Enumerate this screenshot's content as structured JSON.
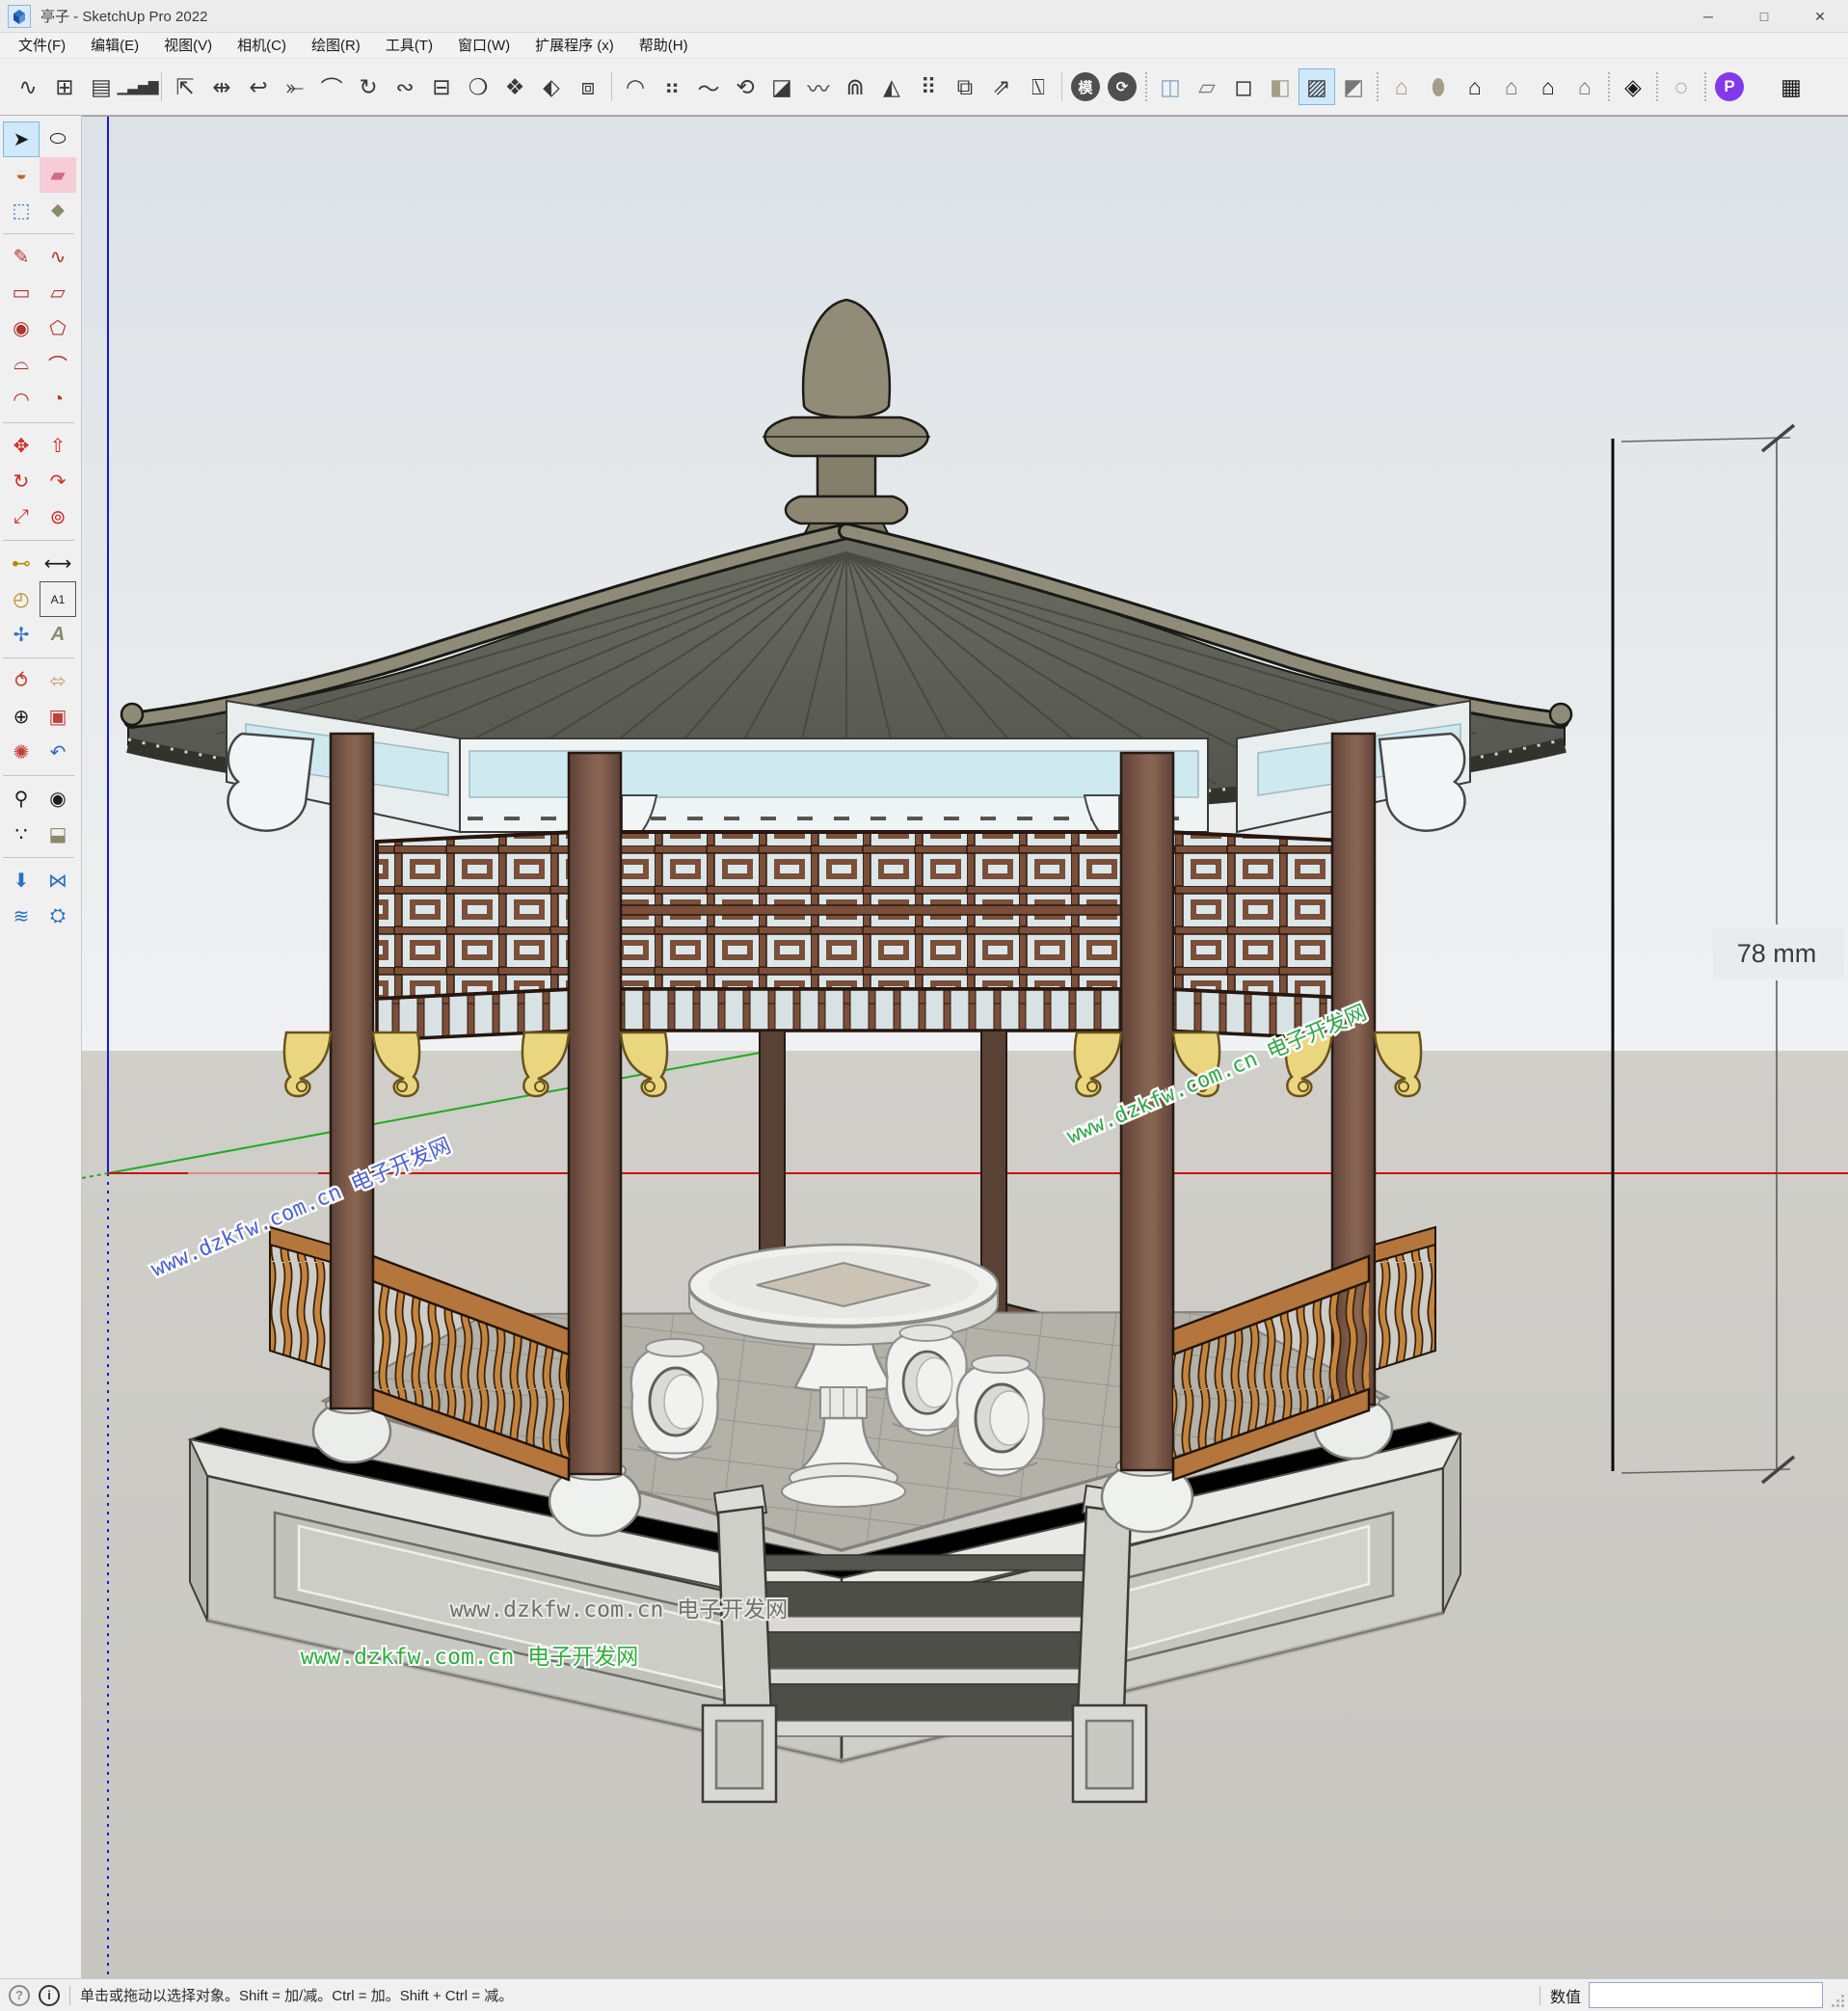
{
  "window": {
    "title": "亭子 - SketchUp Pro 2022",
    "controls": {
      "minimize": "─",
      "maximize": "□",
      "close": "✕"
    }
  },
  "menubar": {
    "items": [
      "文件(F)",
      "编辑(E)",
      "视图(V)",
      "相机(C)",
      "绘图(R)",
      "工具(T)",
      "窗口(W)",
      "扩展程序 (x)",
      "帮助(H)"
    ]
  },
  "toolbar": {
    "icons": [
      {
        "name": "curviloft",
        "glyph": "∿"
      },
      {
        "name": "default-tray",
        "glyph": "⊞"
      },
      {
        "name": "stairs-tool",
        "glyph": "▤"
      },
      {
        "name": "histogram-tool",
        "glyph": "▁▃▅▇"
      },
      {
        "name": "fredo-scale",
        "glyph": "⇱"
      },
      {
        "name": "spacing-tool",
        "glyph": "⇹"
      },
      {
        "name": "curve-bend",
        "glyph": "↩"
      },
      {
        "name": "curve-anchor",
        "glyph": "⤜"
      },
      {
        "name": "bezier-curve",
        "glyph": "⌒"
      },
      {
        "name": "loop-curve",
        "glyph": "↻"
      },
      {
        "name": "curvizard",
        "glyph": "∾"
      },
      {
        "name": "joint-pushpull",
        "glyph": "⊟"
      },
      {
        "name": "vector-pen",
        "glyph": "❍"
      },
      {
        "name": "diamond-array",
        "glyph": "❖"
      },
      {
        "name": "diamond-move",
        "glyph": "⬖"
      },
      {
        "name": "solid-select",
        "glyph": "⧈"
      },
      {
        "name": "round-corner",
        "glyph": "◠"
      },
      {
        "name": "bead-chain",
        "glyph": "⠶"
      },
      {
        "name": "curve-sketch",
        "glyph": "〜"
      },
      {
        "name": "spiral-tool",
        "glyph": "⟲"
      },
      {
        "name": "half-plane",
        "glyph": "◪"
      },
      {
        "name": "wave-hand",
        "glyph": "〰"
      },
      {
        "name": "pipe-tool",
        "glyph": "⋒"
      },
      {
        "name": "mirror-tool",
        "glyph": "◭"
      },
      {
        "name": "dot-grid",
        "glyph": "⠿"
      },
      {
        "name": "layer-copy",
        "glyph": "⧉"
      },
      {
        "name": "north-arrow",
        "glyph": "⇗"
      },
      {
        "name": "broom-clean",
        "glyph": "⍂"
      },
      {
        "name": "mo-badge",
        "glyph": "模"
      },
      {
        "name": "rotate-badge",
        "glyph": "⟳"
      },
      {
        "name": "xray-style",
        "glyph": "◫"
      },
      {
        "name": "wireframe-style",
        "glyph": "▱"
      },
      {
        "name": "hiddenline-style",
        "glyph": "◻"
      },
      {
        "name": "shaded-style",
        "glyph": "◧"
      },
      {
        "name": "textured-style",
        "glyph": "▨"
      },
      {
        "name": "monochrome-style",
        "glyph": "◩"
      },
      {
        "name": "textured-house",
        "glyph": "⌂"
      },
      {
        "name": "component-cylinder",
        "glyph": "⬮"
      },
      {
        "name": "house-solid",
        "glyph": "⌂"
      },
      {
        "name": "house-chimney",
        "glyph": "⌂"
      },
      {
        "name": "house-outline",
        "glyph": "⌂"
      },
      {
        "name": "house-flat",
        "glyph": "⌂"
      },
      {
        "name": "section-compass",
        "glyph": "◈"
      },
      {
        "name": "soften-edges",
        "glyph": "◌"
      },
      {
        "name": "p-plugin-badge",
        "glyph": "P"
      },
      {
        "name": "grid-panel",
        "glyph": "▦"
      }
    ]
  },
  "palette": {
    "selected_tool": "select",
    "tools": [
      {
        "name": "select",
        "glyph": "➤"
      },
      {
        "name": "lasso",
        "glyph": "⬭"
      },
      {
        "name": "paint-bucket",
        "glyph": "◒"
      },
      {
        "name": "eraser",
        "glyph": "▰"
      },
      {
        "name": "make-component",
        "glyph": "⬚"
      },
      {
        "name": "tag",
        "glyph": "⬥"
      },
      {
        "name": "line",
        "glyph": "✎"
      },
      {
        "name": "freehand",
        "glyph": "∿"
      },
      {
        "name": "rectangle",
        "glyph": "▭"
      },
      {
        "name": "rotated-rectangle",
        "glyph": "▱"
      },
      {
        "name": "circle",
        "glyph": "◉"
      },
      {
        "name": "polygon",
        "glyph": "⬠"
      },
      {
        "name": "two-point-arc",
        "glyph": "⌓"
      },
      {
        "name": "arc",
        "glyph": "⌒"
      },
      {
        "name": "three-point-arc",
        "glyph": "◠"
      },
      {
        "name": "pie",
        "glyph": "◔"
      },
      {
        "name": "move",
        "glyph": "✥"
      },
      {
        "name": "push-pull",
        "glyph": "⇧"
      },
      {
        "name": "rotate",
        "glyph": "↻"
      },
      {
        "name": "follow-me",
        "glyph": "↷"
      },
      {
        "name": "scale",
        "glyph": "⤢"
      },
      {
        "name": "offset",
        "glyph": "⊚"
      },
      {
        "name": "tape-measure",
        "glyph": "⊷"
      },
      {
        "name": "dimension",
        "glyph": "⟷"
      },
      {
        "name": "protractor",
        "glyph": "◴"
      },
      {
        "name": "text",
        "glyph": "A1"
      },
      {
        "name": "axes",
        "glyph": "✢"
      },
      {
        "name": "3d-text",
        "glyph": "A"
      },
      {
        "name": "orbit",
        "glyph": "⥀"
      },
      {
        "name": "pan",
        "glyph": "⬄"
      },
      {
        "name": "zoom",
        "glyph": "⊕"
      },
      {
        "name": "zoom-window",
        "glyph": "▣"
      },
      {
        "name": "zoom-extents",
        "glyph": "✺"
      },
      {
        "name": "previous-view",
        "glyph": "↶"
      },
      {
        "name": "position-camera",
        "glyph": "⚲"
      },
      {
        "name": "look-around",
        "glyph": "◉"
      },
      {
        "name": "walk",
        "glyph": "∵"
      },
      {
        "name": "section-plane",
        "glyph": "⬓"
      },
      {
        "name": "ext-import",
        "glyph": "⬇"
      },
      {
        "name": "ext-flip",
        "glyph": "⋈"
      },
      {
        "name": "ext-layers",
        "glyph": "≋"
      },
      {
        "name": "ext-settings",
        "glyph": "⛭"
      }
    ]
  },
  "viewport": {
    "dimension_label": "78 mm",
    "watermark_text": "www.dzkfw.com.cn 电子开发网",
    "axes": {
      "red": "#cc1111",
      "green": "#22aa22",
      "blue": "#1a1acc"
    },
    "model_name": "chinese-hexagonal-pavilion"
  },
  "statusbar": {
    "help_glyph": "?",
    "info_glyph": "i",
    "hint": "单击或拖动以选择对象。Shift = 加/减。Ctrl = 加。Shift + Ctrl = 减。",
    "value_label": "数值",
    "value_input": ""
  },
  "colors": {
    "selection_highlight": "#cfe8fa",
    "roof": "#5f6057",
    "ridge": "#8e8b78",
    "column_wood": "#7d5b4b",
    "lattice_wood": "#7b4f39",
    "gold_bracket": "#ead67f",
    "railing_wood": "#c5853f",
    "stone_base": "#c9c9c4",
    "furniture_white": "#f1f2f0",
    "watermark_blue": "#4a5fd0",
    "watermark_green": "#2fae3f",
    "watermark_gray": "#707070"
  }
}
